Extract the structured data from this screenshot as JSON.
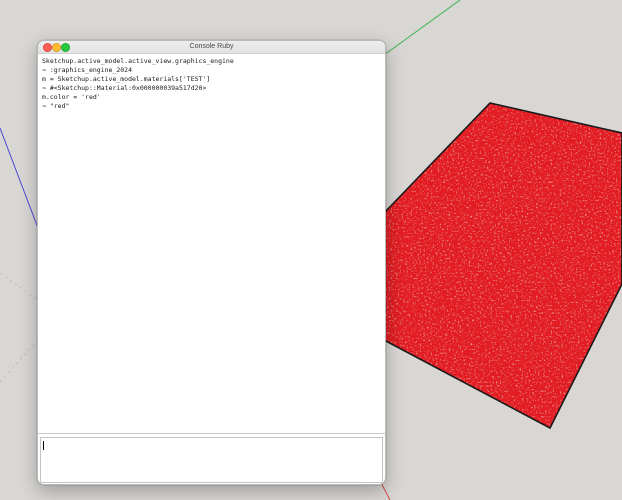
{
  "window": {
    "title": "Console Ruby"
  },
  "output_lines": [
    "Sketchup.active_model.active_view.graphics_engine",
    "⇒ :graphics_engine_2024",
    "m = Sketchup.active_model.materials['TEST']",
    "⇒ #<Sketchup::Material:0x000000039a517d20>",
    "m.color = 'red'",
    "⇒ \"red\""
  ],
  "input": {
    "value": ""
  },
  "colors": {
    "viewport_background": "#d9d7d4",
    "material_red": "#e21d22",
    "axis_green": "#3bb34a",
    "axis_blue": "#3a3ad6",
    "axis_red": "#d63a3a"
  }
}
